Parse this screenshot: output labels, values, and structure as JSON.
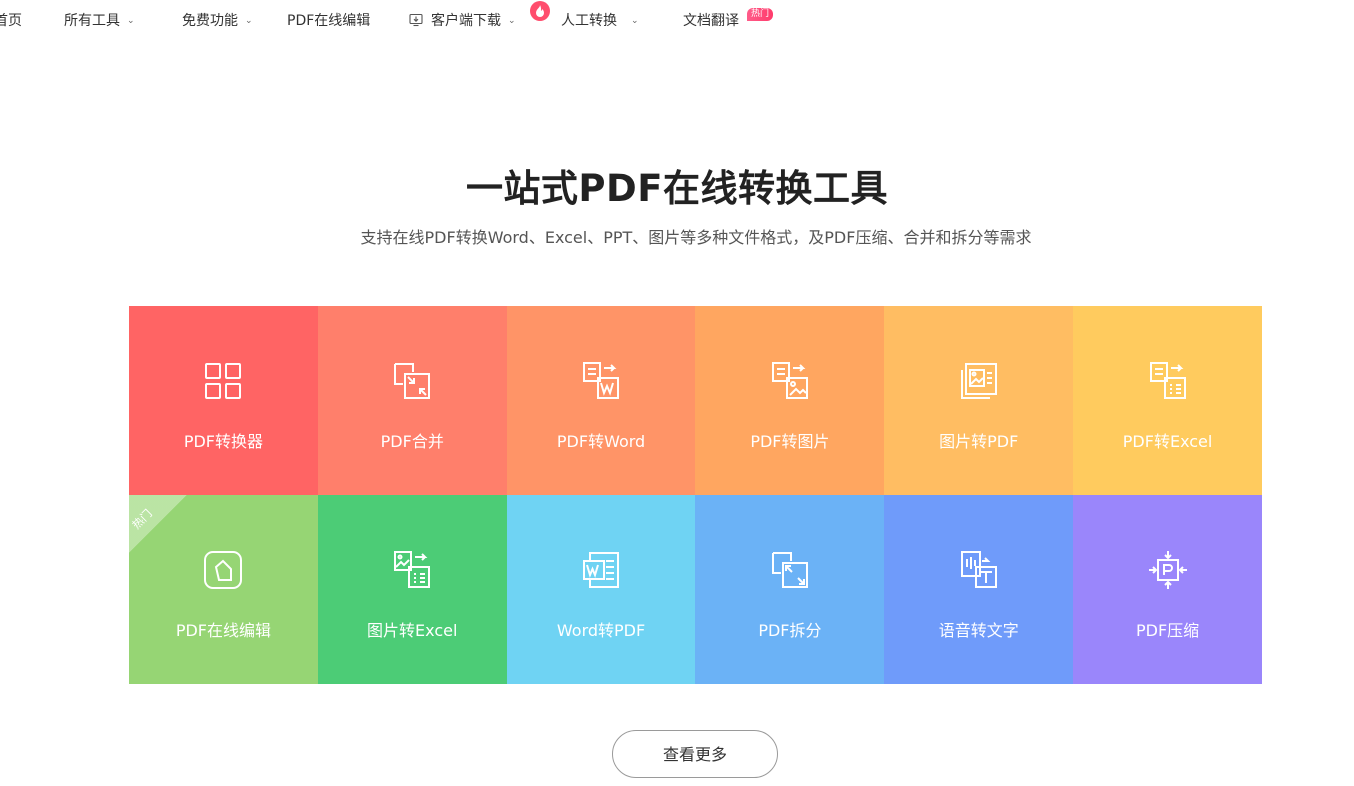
{
  "nav": {
    "home": "首页",
    "all_tools": "所有工具",
    "free": "免费功能",
    "edit": "PDF在线编辑",
    "download": "客户端下载",
    "manual": "人工转换",
    "translate": "文档翻译",
    "hot_badge": "热门"
  },
  "hero": {
    "title": "一站式PDF在线转换工具",
    "subtitle": "支持在线PDF转换Word、Excel、PPT、图片等多种文件格式，及PDF压缩、合并和拆分等需求"
  },
  "tiles": [
    {
      "label": "PDF转换器",
      "color": "#ff6464",
      "icon": "grid-icon"
    },
    {
      "label": "PDF合并",
      "color": "#ff7f6b",
      "icon": "merge-icon"
    },
    {
      "label": "PDF转Word",
      "color": "#ff9467",
      "icon": "pdf-to-word-icon"
    },
    {
      "label": "PDF转图片",
      "color": "#ffa660",
      "icon": "pdf-to-image-icon"
    },
    {
      "label": "图片转PDF",
      "color": "#ffbd62",
      "icon": "image-to-pdf-icon"
    },
    {
      "label": "PDF转Excel",
      "color": "#ffcb5e",
      "icon": "pdf-to-excel-icon"
    },
    {
      "label": "PDF在线编辑",
      "color": "#96d574",
      "icon": "edit-icon",
      "corner": "热门"
    },
    {
      "label": "图片转Excel",
      "color": "#4ccc76",
      "icon": "image-to-excel-icon"
    },
    {
      "label": "Word转PDF",
      "color": "#6fd3f3",
      "icon": "word-to-pdf-icon"
    },
    {
      "label": "PDF拆分",
      "color": "#6bb2f6",
      "icon": "split-icon"
    },
    {
      "label": "语音转文字",
      "color": "#6f9bfa",
      "icon": "speech-to-text-icon"
    },
    {
      "label": "PDF压缩",
      "color": "#9a86fb",
      "icon": "compress-icon"
    }
  ],
  "more_button": "查看更多"
}
